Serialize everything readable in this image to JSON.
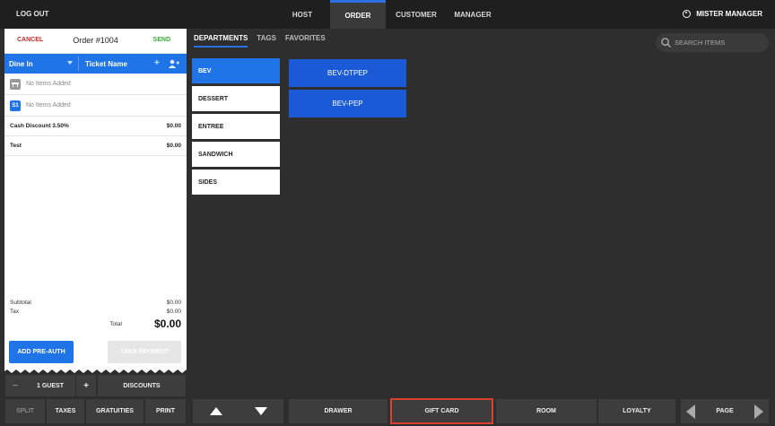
{
  "topbar": {
    "logout": "LOG OUT",
    "nav": [
      "HOST",
      "ORDER",
      "CUSTOMER",
      "MANAGER"
    ],
    "active_nav": "ORDER",
    "user": "MISTER MANAGER"
  },
  "order": {
    "cancel": "CANCEL",
    "title": "Order #1004",
    "send": "SEND",
    "dine_type": "Dine In",
    "ticket_name": "Ticket Name",
    "seat_rows": [
      {
        "tag": "",
        "text": "No Items Added"
      },
      {
        "tag": "S1",
        "text": "No Items Added"
      }
    ],
    "lines": [
      {
        "label": "Cash Discount 3.50%",
        "amount": "$0.00"
      },
      {
        "label": "Test",
        "amount": "$0.00"
      }
    ],
    "subtotal_label": "Subtotal",
    "subtotal": "$0.00",
    "tax_label": "Tax",
    "tax": "$0.00",
    "total_label": "Total",
    "total": "$0.00",
    "preauth": "ADD PRE-AUTH",
    "take_payment": "TAKE PAYMENT"
  },
  "guest_bar": {
    "minus": "−",
    "guests": "1 GUEST",
    "plus": "+",
    "discounts": "DISCOUNTS"
  },
  "action_bar": {
    "split": "SPLIT",
    "taxes": "TAXES",
    "gratuities": "GRATUITIES",
    "print": "PRINT"
  },
  "menu": {
    "tabs": [
      "DEPARTMENTS",
      "TAGS",
      "FAVORITES"
    ],
    "search_placeholder": "SEARCH ITEMS",
    "departments": [
      "BEV",
      "DESSERT",
      "ENTREE",
      "SANDWICH",
      "SIDES"
    ],
    "active_department": "BEV",
    "items": [
      "BEV-DTPEP",
      "BEV-PEP"
    ]
  },
  "bottom": {
    "drawer": "DRAWER",
    "gift_card": "GIFT CARD",
    "room": "ROOM",
    "loyalty": "LOYALTY",
    "page": "PAGE"
  },
  "colors": {
    "accent": "#1f74e8",
    "cancel": "#c62828",
    "send": "#3caa3c",
    "highlight": "#d9412d"
  }
}
